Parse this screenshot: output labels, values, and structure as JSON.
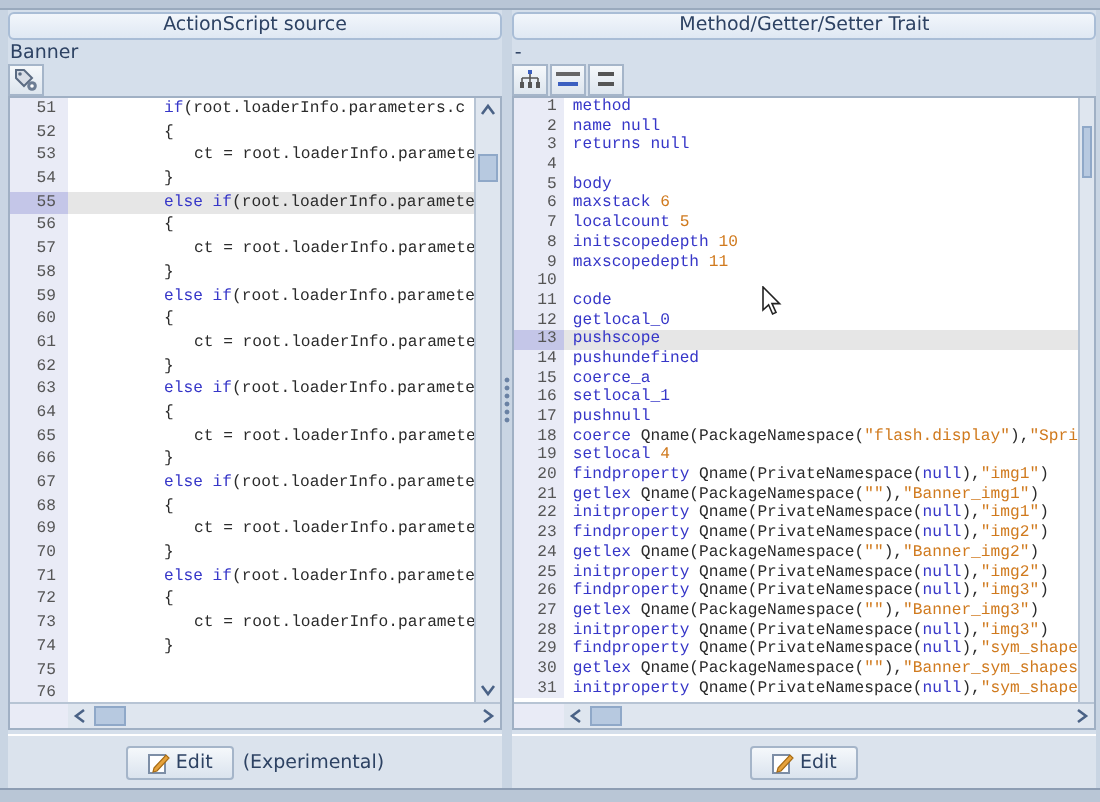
{
  "left_panel": {
    "title": "ActionScript source",
    "label": "Banner",
    "lines": [
      {
        "number": "51",
        "selected": false,
        "kind": "outer",
        "parts": [
          {
            "kind": "keyword",
            "text": "if"
          },
          {
            "kind": "plain",
            "text": "(root.loaderInfo.parameters.c"
          }
        ]
      },
      {
        "number": "52",
        "selected": false,
        "kind": "outer",
        "parts": [
          {
            "kind": "plain",
            "text": "{"
          }
        ]
      },
      {
        "number": "53",
        "selected": false,
        "kind": "inner",
        "parts": [
          {
            "kind": "plain",
            "text": "ct = root.loaderInfo.paramete"
          }
        ]
      },
      {
        "number": "54",
        "selected": false,
        "kind": "outer",
        "parts": [
          {
            "kind": "plain",
            "text": "}"
          }
        ]
      },
      {
        "number": "55",
        "selected": true,
        "kind": "outer",
        "parts": [
          {
            "kind": "keyword",
            "text": "else if"
          },
          {
            "kind": "plain",
            "text": "(root.loaderInfo.paramete"
          }
        ]
      },
      {
        "number": "56",
        "selected": false,
        "kind": "outer",
        "parts": [
          {
            "kind": "plain",
            "text": "{"
          }
        ]
      },
      {
        "number": "57",
        "selected": false,
        "kind": "inner",
        "parts": [
          {
            "kind": "plain",
            "text": "ct = root.loaderInfo.paramete"
          }
        ]
      },
      {
        "number": "58",
        "selected": false,
        "kind": "outer",
        "parts": [
          {
            "kind": "plain",
            "text": "}"
          }
        ]
      },
      {
        "number": "59",
        "selected": false,
        "kind": "outer",
        "parts": [
          {
            "kind": "keyword",
            "text": "else if"
          },
          {
            "kind": "plain",
            "text": "(root.loaderInfo.paramete"
          }
        ]
      },
      {
        "number": "60",
        "selected": false,
        "kind": "outer",
        "parts": [
          {
            "kind": "plain",
            "text": "{"
          }
        ]
      },
      {
        "number": "61",
        "selected": false,
        "kind": "inner",
        "parts": [
          {
            "kind": "plain",
            "text": "ct = root.loaderInfo.paramete"
          }
        ]
      },
      {
        "number": "62",
        "selected": false,
        "kind": "outer",
        "parts": [
          {
            "kind": "plain",
            "text": "}"
          }
        ]
      },
      {
        "number": "63",
        "selected": false,
        "kind": "outer",
        "parts": [
          {
            "kind": "keyword",
            "text": "else if"
          },
          {
            "kind": "plain",
            "text": "(root.loaderInfo.paramete"
          }
        ]
      },
      {
        "number": "64",
        "selected": false,
        "kind": "outer",
        "parts": [
          {
            "kind": "plain",
            "text": "{"
          }
        ]
      },
      {
        "number": "65",
        "selected": false,
        "kind": "inner",
        "parts": [
          {
            "kind": "plain",
            "text": "ct = root.loaderInfo.paramete"
          }
        ]
      },
      {
        "number": "66",
        "selected": false,
        "kind": "outer",
        "parts": [
          {
            "kind": "plain",
            "text": "}"
          }
        ]
      },
      {
        "number": "67",
        "selected": false,
        "kind": "outer",
        "parts": [
          {
            "kind": "keyword",
            "text": "else if"
          },
          {
            "kind": "plain",
            "text": "(root.loaderInfo.paramete"
          }
        ]
      },
      {
        "number": "68",
        "selected": false,
        "kind": "outer",
        "parts": [
          {
            "kind": "plain",
            "text": "{"
          }
        ]
      },
      {
        "number": "69",
        "selected": false,
        "kind": "inner",
        "parts": [
          {
            "kind": "plain",
            "text": "ct = root.loaderInfo.paramete"
          }
        ]
      },
      {
        "number": "70",
        "selected": false,
        "kind": "outer",
        "parts": [
          {
            "kind": "plain",
            "text": "}"
          }
        ]
      },
      {
        "number": "71",
        "selected": false,
        "kind": "outer",
        "parts": [
          {
            "kind": "keyword",
            "text": "else if"
          },
          {
            "kind": "plain",
            "text": "(root.loaderInfo.paramete"
          }
        ]
      },
      {
        "number": "72",
        "selected": false,
        "kind": "outer",
        "parts": [
          {
            "kind": "plain",
            "text": "{"
          }
        ]
      },
      {
        "number": "73",
        "selected": false,
        "kind": "inner",
        "parts": [
          {
            "kind": "plain",
            "text": "ct = root.loaderInfo.paramete"
          }
        ]
      },
      {
        "number": "74",
        "selected": false,
        "kind": "outer",
        "parts": [
          {
            "kind": "plain",
            "text": "}"
          }
        ]
      },
      {
        "number": "75",
        "selected": false
      },
      {
        "number": "76",
        "selected": false
      }
    ],
    "edit_button": "Edit",
    "note": "(Experimental)"
  },
  "right_panel": {
    "title": "Method/Getter/Setter Trait",
    "label": "-",
    "lines": [
      {
        "number": "1",
        "selected": false,
        "parts": [
          {
            "kind": "keyword",
            "text": "method"
          }
        ]
      },
      {
        "number": "2",
        "selected": false,
        "parts": [
          {
            "kind": "keyword",
            "text": "name null"
          }
        ]
      },
      {
        "number": "3",
        "selected": false,
        "parts": [
          {
            "kind": "keyword",
            "text": "returns null"
          }
        ]
      },
      {
        "number": "4",
        "selected": false
      },
      {
        "number": "5",
        "selected": false,
        "parts": [
          {
            "kind": "keyword",
            "text": "body"
          }
        ]
      },
      {
        "number": "6",
        "selected": false,
        "parts": [
          {
            "kind": "keyword",
            "text": "maxstack "
          },
          {
            "kind": "number",
            "text": "6"
          }
        ]
      },
      {
        "number": "7",
        "selected": false,
        "parts": [
          {
            "kind": "keyword",
            "text": "localcount "
          },
          {
            "kind": "number",
            "text": "5"
          }
        ]
      },
      {
        "number": "8",
        "selected": false,
        "parts": [
          {
            "kind": "keyword",
            "text": "initscopedepth "
          },
          {
            "kind": "number",
            "text": "10"
          }
        ]
      },
      {
        "number": "9",
        "selected": false,
        "parts": [
          {
            "kind": "keyword",
            "text": "maxscopedepth "
          },
          {
            "kind": "number",
            "text": "11"
          }
        ]
      },
      {
        "number": "10",
        "selected": false
      },
      {
        "number": "11",
        "selected": false,
        "parts": [
          {
            "kind": "keyword",
            "text": "code"
          }
        ]
      },
      {
        "number": "12",
        "selected": false,
        "parts": [
          {
            "kind": "keyword",
            "text": "getlocal_0"
          }
        ]
      },
      {
        "number": "13",
        "selected": true,
        "parts": [
          {
            "kind": "keyword",
            "text": "pushscope"
          }
        ]
      },
      {
        "number": "14",
        "selected": false,
        "parts": [
          {
            "kind": "keyword",
            "text": "pushundefined"
          }
        ]
      },
      {
        "number": "15",
        "selected": false,
        "parts": [
          {
            "kind": "keyword",
            "text": "coerce_a"
          }
        ]
      },
      {
        "number": "16",
        "selected": false,
        "parts": [
          {
            "kind": "keyword",
            "text": "setlocal_1"
          }
        ]
      },
      {
        "number": "17",
        "selected": false,
        "parts": [
          {
            "kind": "keyword",
            "text": "pushnull"
          }
        ]
      },
      {
        "number": "18",
        "selected": false,
        "parts": [
          {
            "kind": "keyword",
            "text": "coerce "
          },
          {
            "kind": "plain",
            "text": "Qname(PackageNamespace("
          },
          {
            "kind": "string",
            "text": "\"flash.display\""
          },
          {
            "kind": "plain",
            "text": "),"
          },
          {
            "kind": "string",
            "text": "\"Spri"
          }
        ]
      },
      {
        "number": "19",
        "selected": false,
        "parts": [
          {
            "kind": "keyword",
            "text": "setlocal "
          },
          {
            "kind": "number",
            "text": "4"
          }
        ]
      },
      {
        "number": "20",
        "selected": false,
        "parts": [
          {
            "kind": "keyword",
            "text": "findproperty "
          },
          {
            "kind": "plain",
            "text": "Qname(PrivateNamespace("
          },
          {
            "kind": "keyword",
            "text": "null"
          },
          {
            "kind": "plain",
            "text": "),"
          },
          {
            "kind": "string",
            "text": "\"img1\""
          },
          {
            "kind": "plain",
            "text": ")"
          }
        ]
      },
      {
        "number": "21",
        "selected": false,
        "parts": [
          {
            "kind": "keyword",
            "text": "getlex "
          },
          {
            "kind": "plain",
            "text": "Qname(PackageNamespace("
          },
          {
            "kind": "string",
            "text": "\"\""
          },
          {
            "kind": "plain",
            "text": "),"
          },
          {
            "kind": "string",
            "text": "\"Banner_img1\""
          },
          {
            "kind": "plain",
            "text": ")"
          }
        ]
      },
      {
        "number": "22",
        "selected": false,
        "parts": [
          {
            "kind": "keyword",
            "text": "initproperty "
          },
          {
            "kind": "plain",
            "text": "Qname(PrivateNamespace("
          },
          {
            "kind": "keyword",
            "text": "null"
          },
          {
            "kind": "plain",
            "text": "),"
          },
          {
            "kind": "string",
            "text": "\"img1\""
          },
          {
            "kind": "plain",
            "text": ")"
          }
        ]
      },
      {
        "number": "23",
        "selected": false,
        "parts": [
          {
            "kind": "keyword",
            "text": "findproperty "
          },
          {
            "kind": "plain",
            "text": "Qname(PrivateNamespace("
          },
          {
            "kind": "keyword",
            "text": "null"
          },
          {
            "kind": "plain",
            "text": "),"
          },
          {
            "kind": "string",
            "text": "\"img2\""
          },
          {
            "kind": "plain",
            "text": ")"
          }
        ]
      },
      {
        "number": "24",
        "selected": false,
        "parts": [
          {
            "kind": "keyword",
            "text": "getlex "
          },
          {
            "kind": "plain",
            "text": "Qname(PackageNamespace("
          },
          {
            "kind": "string",
            "text": "\"\""
          },
          {
            "kind": "plain",
            "text": "),"
          },
          {
            "kind": "string",
            "text": "\"Banner_img2\""
          },
          {
            "kind": "plain",
            "text": ")"
          }
        ]
      },
      {
        "number": "25",
        "selected": false,
        "parts": [
          {
            "kind": "keyword",
            "text": "initproperty "
          },
          {
            "kind": "plain",
            "text": "Qname(PrivateNamespace("
          },
          {
            "kind": "keyword",
            "text": "null"
          },
          {
            "kind": "plain",
            "text": "),"
          },
          {
            "kind": "string",
            "text": "\"img2\""
          },
          {
            "kind": "plain",
            "text": ")"
          }
        ]
      },
      {
        "number": "26",
        "selected": false,
        "parts": [
          {
            "kind": "keyword",
            "text": "findproperty "
          },
          {
            "kind": "plain",
            "text": "Qname(PrivateNamespace("
          },
          {
            "kind": "keyword",
            "text": "null"
          },
          {
            "kind": "plain",
            "text": "),"
          },
          {
            "kind": "string",
            "text": "\"img3\""
          },
          {
            "kind": "plain",
            "text": ")"
          }
        ]
      },
      {
        "number": "27",
        "selected": false,
        "parts": [
          {
            "kind": "keyword",
            "text": "getlex "
          },
          {
            "kind": "plain",
            "text": "Qname(PackageNamespace("
          },
          {
            "kind": "string",
            "text": "\"\""
          },
          {
            "kind": "plain",
            "text": "),"
          },
          {
            "kind": "string",
            "text": "\"Banner_img3\""
          },
          {
            "kind": "plain",
            "text": ")"
          }
        ]
      },
      {
        "number": "28",
        "selected": false,
        "parts": [
          {
            "kind": "keyword",
            "text": "initproperty "
          },
          {
            "kind": "plain",
            "text": "Qname(PrivateNamespace("
          },
          {
            "kind": "keyword",
            "text": "null"
          },
          {
            "kind": "plain",
            "text": "),"
          },
          {
            "kind": "string",
            "text": "\"img3\""
          },
          {
            "kind": "plain",
            "text": ")"
          }
        ]
      },
      {
        "number": "29",
        "selected": false,
        "parts": [
          {
            "kind": "keyword",
            "text": "findproperty "
          },
          {
            "kind": "plain",
            "text": "Qname(PrivateNamespace("
          },
          {
            "kind": "keyword",
            "text": "null"
          },
          {
            "kind": "plain",
            "text": "),"
          },
          {
            "kind": "string",
            "text": "\"sym_shape"
          }
        ]
      },
      {
        "number": "30",
        "selected": false,
        "parts": [
          {
            "kind": "keyword",
            "text": "getlex "
          },
          {
            "kind": "plain",
            "text": "Qname(PackageNamespace("
          },
          {
            "kind": "string",
            "text": "\"\""
          },
          {
            "kind": "plain",
            "text": "),"
          },
          {
            "kind": "string",
            "text": "\"Banner_sym_shapes"
          }
        ]
      },
      {
        "number": "31",
        "selected": false,
        "parts": [
          {
            "kind": "keyword",
            "text": "initproperty "
          },
          {
            "kind": "plain",
            "text": "Qname(PrivateNamespace("
          },
          {
            "kind": "keyword",
            "text": "null"
          },
          {
            "kind": "plain",
            "text": "),"
          },
          {
            "kind": "string",
            "text": "\"sym_shape"
          }
        ]
      }
    ],
    "edit_button": "Edit"
  }
}
